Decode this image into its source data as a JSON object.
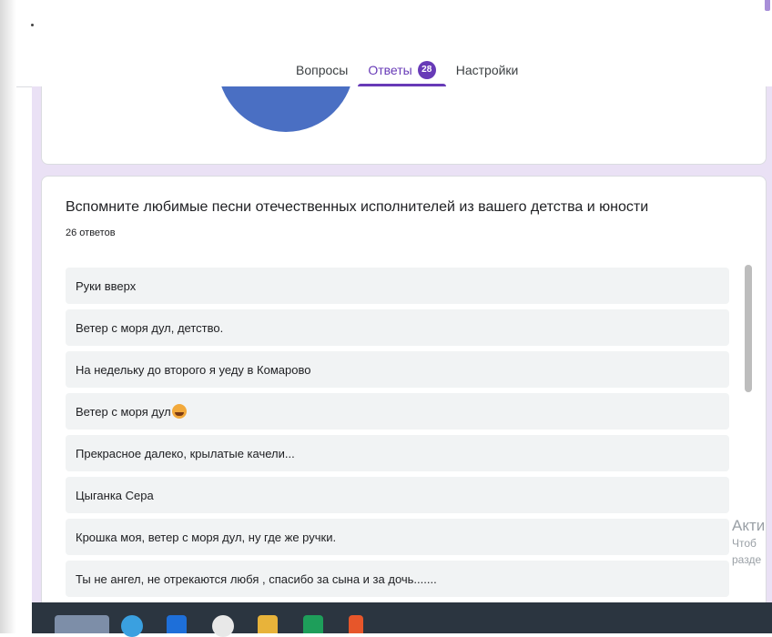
{
  "tabs": {
    "questions": "Вопросы",
    "responses": "Ответы",
    "responses_count": "28",
    "settings": "Настройки"
  },
  "question": {
    "title": "Вспомните любимые песни отечественных исполнителей из вашего детства и юности",
    "count": "26 ответов",
    "answers": [
      "Руки вверх",
      "Ветер с моря дул, детство.",
      "На недельку до второго я уеду в Комарово",
      "Ветер с моря дул",
      "Прекрасное далеко, крылатые качели...",
      "Цыганка Сера",
      "Крошка моя, ветер с моря дул, ну где же ручки.",
      "Ты не ангел, не отрекаются любя , спасибо за сына и за дочь......."
    ]
  },
  "watermark": {
    "title": "Акти",
    "line1": "Чтоб",
    "line2": "разде"
  },
  "colors": {
    "accent": "#673ab7",
    "pie": "#4a6fc3",
    "background": "#eae1f5"
  }
}
